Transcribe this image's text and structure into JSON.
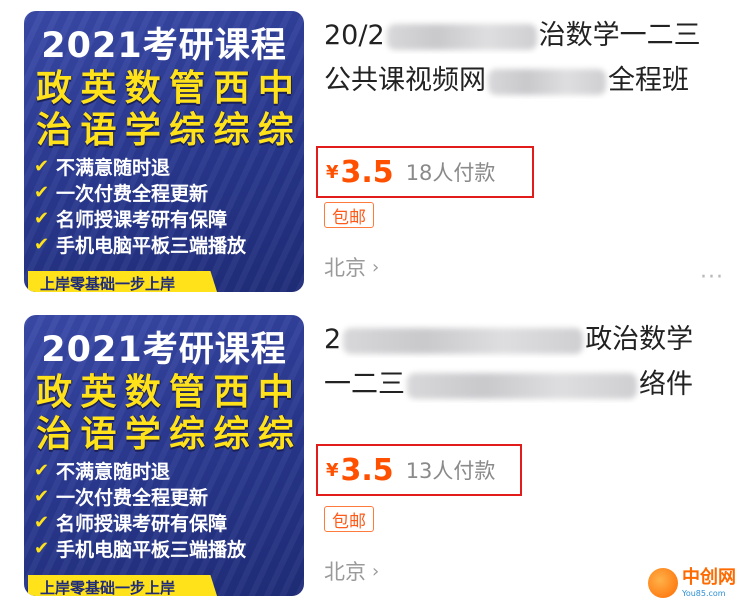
{
  "listings": [
    {
      "thumb": {
        "title": "2021考研课程",
        "subjects": [
          "政",
          "英",
          "数",
          "管",
          "西",
          "中",
          "治",
          "语",
          "学",
          "综",
          "综",
          "综"
        ],
        "features": [
          "不满意随时退",
          "一次付费全程更新",
          "名师授课考研有保障",
          "手机电脑平板三端播放"
        ],
        "banner": "上岸零基础一步上岸"
      },
      "title_line1_a": "20/2",
      "title_line1_b": "治数学一二三",
      "title_line2_a": "公共课视频网",
      "title_line2_b": "全程班",
      "currency": "¥",
      "price": "3.5",
      "paid": "18人付款",
      "tag": "包邮",
      "location": "北京"
    },
    {
      "thumb": {
        "title": "2021考研课程",
        "subjects": [
          "政",
          "英",
          "数",
          "管",
          "西",
          "中",
          "治",
          "语",
          "学",
          "综",
          "综",
          "综"
        ],
        "features": [
          "不满意随时退",
          "一次付费全程更新",
          "名师授课考研有保障",
          "手机电脑平板三端播放"
        ],
        "banner": "上岸零基础一步上岸"
      },
      "title_line1_a": "2",
      "title_line1_b": "政治数学",
      "title_line2_a": "一二三",
      "title_line2_b": "络件",
      "currency": "¥",
      "price": "3.5",
      "paid": "13人付款",
      "tag": "包邮",
      "location": "北京"
    }
  ],
  "more_icon": "more-dots-icon",
  "watermark": {
    "main": "中创网",
    "sub": "You85.com"
  },
  "colors": {
    "accent": "#ff5000",
    "highlight_border": "#e21b1b",
    "thumb_bg": "#2b3a92",
    "thumb_text": "#ffe21a"
  }
}
